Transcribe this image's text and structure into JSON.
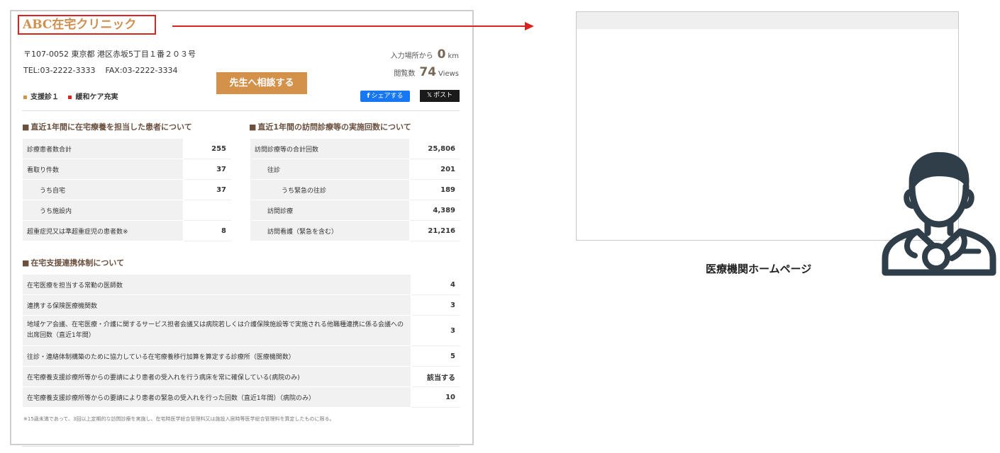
{
  "clinic": {
    "name": "ABC在宅クリニック",
    "address": "〒107-0052 東京都 港区赤坂5丁目１番２０３号",
    "tel_label": "TEL:",
    "tel": "03-2222-3333",
    "fax_label": "FAX:",
    "fax": "03-2222-3334",
    "distance_label": "入力場所から",
    "distance_value": "0",
    "distance_unit": "km",
    "views_label": "閲覧数",
    "views_value": "74",
    "views_unit": "Views",
    "consult_button": "先生へ相談する",
    "tags": [
      {
        "label": "支援診１",
        "color": "#d4914a"
      },
      {
        "label": "緩和ケア充実",
        "color": "#d8231f"
      }
    ],
    "share_facebook": "シェアする",
    "share_x": "ポスト"
  },
  "patients_section": {
    "title": "直近1年間に在宅療養を担当した患者について",
    "rows": [
      {
        "label": "診療患者数合計",
        "value": "255"
      },
      {
        "label": "看取り件数",
        "value": "37"
      },
      {
        "label": "うち自宅",
        "value": "37"
      },
      {
        "label": "うち施設内",
        "value": ""
      },
      {
        "label": "超重症児又は準超重症児の患者数※",
        "value": "8"
      }
    ]
  },
  "visits_section": {
    "title": "直近1年間の訪問診療等の実施回数について",
    "rows": [
      {
        "label": "訪問診療等の合計回数",
        "value": "25,806"
      },
      {
        "label": "往診",
        "value": "201"
      },
      {
        "label": "うち緊急の往診",
        "value": "189"
      },
      {
        "label": "訪問診療",
        "value": "4,389"
      },
      {
        "label": "訪問看護（緊急を含む）",
        "value": "21,216"
      }
    ]
  },
  "support_section": {
    "title": "在宅支援連携体制について",
    "rows": [
      {
        "label": "在宅医療を担当する常勤の医師数",
        "value": "4"
      },
      {
        "label": "連携する保険医療機関数",
        "value": "3"
      },
      {
        "label": "地域ケア会議、在宅医療・介護に関するサービス担者会議又は病院若しくは介護保険施設等で実施される他職種連携に係る会議への出席回数（直近1年間）",
        "value": "3"
      },
      {
        "label": "往診・連絡体制構築のために協力している在宅療養移行加算を算定する診療所（医療機関数）",
        "value": "5"
      },
      {
        "label": "在宅療養支援診療所等からの要請により患者の受入れを行う病床を常に確保している(病院のみ)",
        "value": "該当する"
      },
      {
        "label": "在宅療養支援診療所等からの要請により患者の緊急の受入れを行った回数（直近1年間）（病院のみ）",
        "value": "10"
      }
    ]
  },
  "footnote": "※15歳未満であって、3回以上定期的な訪問診療を実施し、在宅時医学総合管理料又は施設入居時等医学総合管理料を算定したものに限る。",
  "homepage": {
    "label": "医療機関ホームページ"
  },
  "icons": {
    "doctor": "doctor-with-stethoscope-icon",
    "facebook": "facebook-icon",
    "x": "x-logo-icon"
  },
  "colors": {
    "accent": "#d4914a",
    "highlight": "#d8231f",
    "section_title": "#6b5040",
    "facebook": "#1877f2"
  }
}
